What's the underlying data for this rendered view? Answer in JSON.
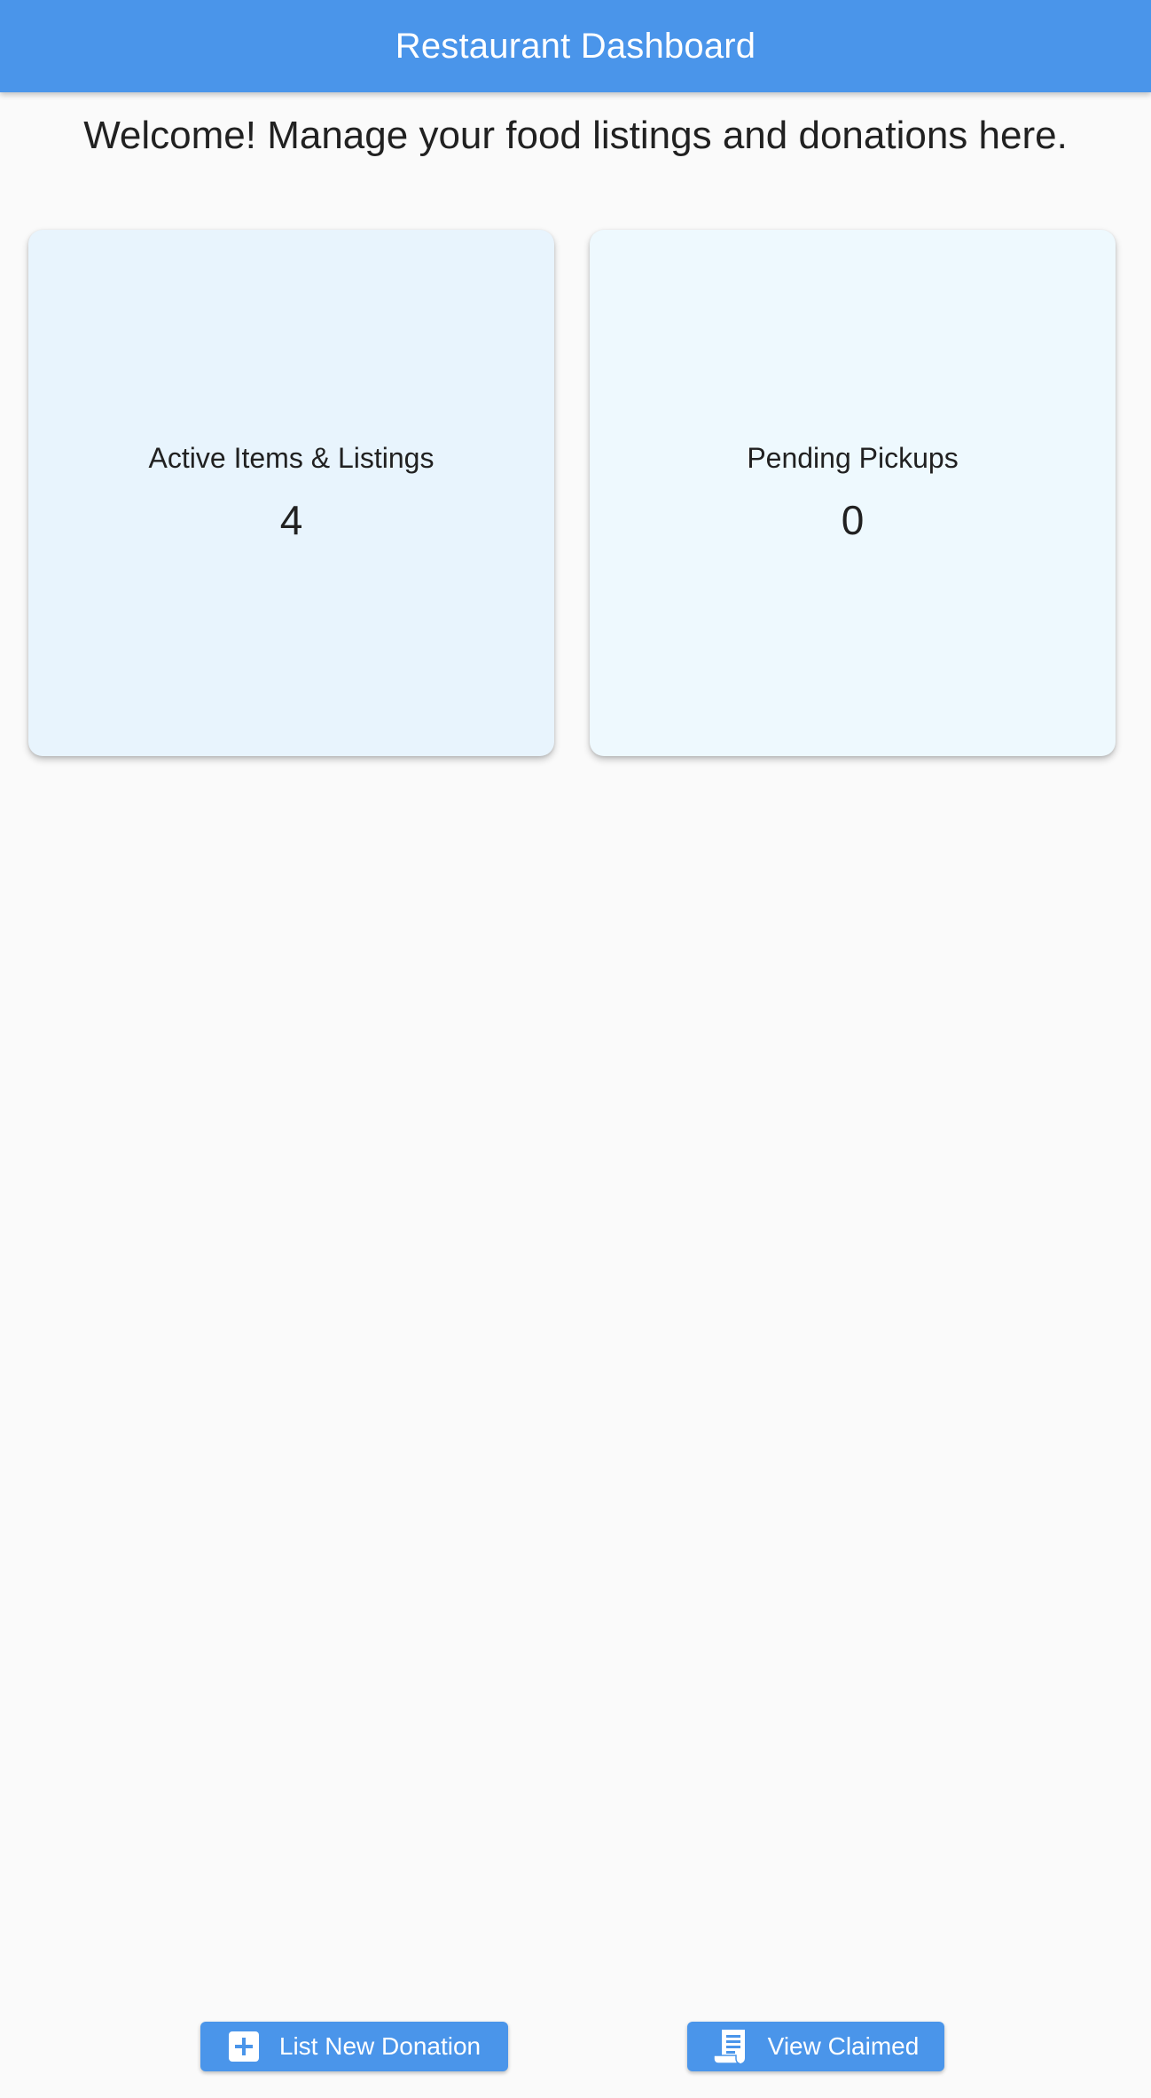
{
  "app_bar": {
    "title": "Restaurant Dashboard",
    "color": "#4a95ea"
  },
  "welcome": {
    "text": "Welcome! Manage your food listings and donations here."
  },
  "cards": [
    {
      "label": "Active Items & Listings",
      "value": "4",
      "color": "#e8f4fd"
    },
    {
      "label": "Pending Pickups",
      "value": "0",
      "color": "#eef9fe"
    }
  ],
  "actions": {
    "list_new_donation": {
      "label": "List New Donation",
      "icon": "add-box-icon"
    },
    "view_claimed": {
      "label": "View Claimed",
      "icon": "receipt-icon"
    }
  }
}
